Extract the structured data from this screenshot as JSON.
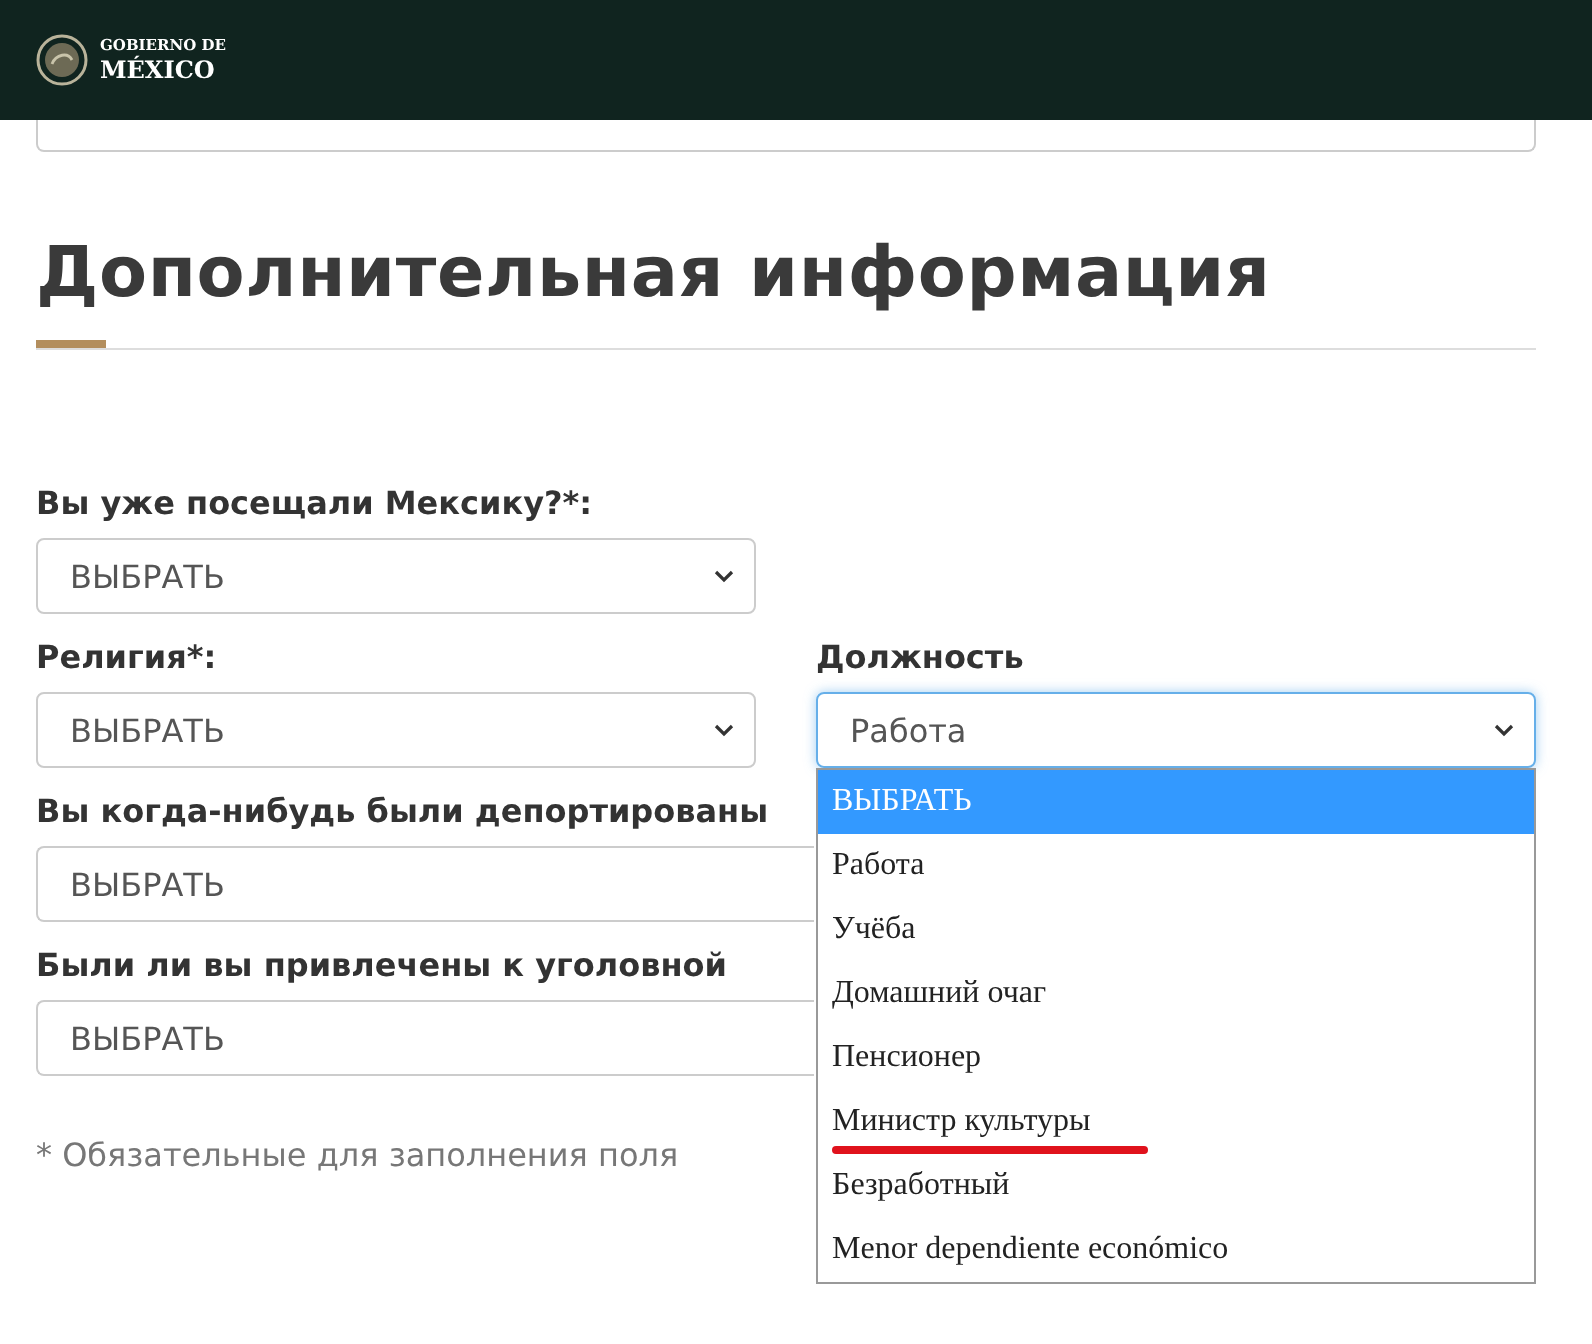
{
  "header": {
    "logo_small": "GOBIERNO DE",
    "logo_large": "MÉXICO"
  },
  "section_title": "Дополнительная информация",
  "rows": [
    [
      {
        "label": "Вы уже посещали Мексику?*:",
        "value": "ВЫБРАТЬ",
        "focused": false
      }
    ],
    [
      {
        "label": "Религия*:",
        "value": "ВЫБРАТЬ",
        "focused": false
      },
      {
        "label": "Должность",
        "value": "Работа",
        "focused": true,
        "open": true
      }
    ],
    [
      {
        "label": "Вы когда-нибудь были депортированы",
        "value": "ВЫБРАТЬ",
        "focused": false,
        "covered": true
      }
    ],
    [
      {
        "label": "Были ли вы привлечены к уголовной",
        "value": "ВЫБРАТЬ",
        "focused": false,
        "covered": true
      }
    ]
  ],
  "dropdown_options": [
    {
      "label": "ВЫБРАТЬ",
      "selected": true,
      "marked": false
    },
    {
      "label": "Работа",
      "selected": false,
      "marked": false
    },
    {
      "label": "Учёба",
      "selected": false,
      "marked": false
    },
    {
      "label": "Домашний очаг",
      "selected": false,
      "marked": false
    },
    {
      "label": "Пенсионер",
      "selected": false,
      "marked": false
    },
    {
      "label": "Министр культуры",
      "selected": false,
      "marked": true
    },
    {
      "label": "Безработный",
      "selected": false,
      "marked": false
    },
    {
      "label": "Menor dependiente económico",
      "selected": false,
      "marked": false
    }
  ],
  "footnote": "* Обязательные для заполнения поля"
}
